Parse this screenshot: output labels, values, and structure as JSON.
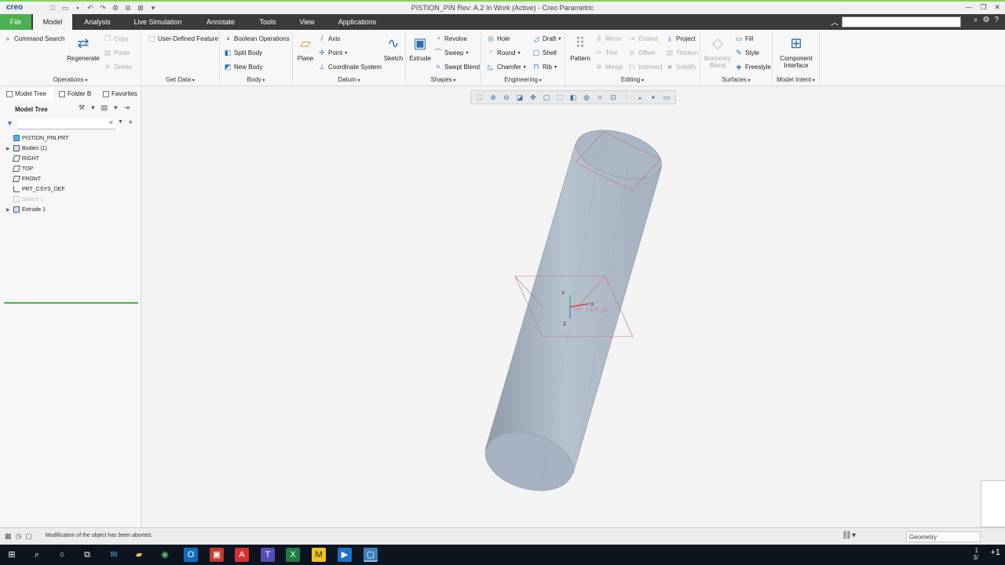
{
  "titlebar": {
    "logo": "creo",
    "window_title": "PISTION_PIN Rev: A.2 In Work  (Active) - Creo Parametric"
  },
  "tabs": [
    "File",
    "Model",
    "Analysis",
    "Live Simulation",
    "Annotate",
    "Tools",
    "View",
    "Applications"
  ],
  "active_tab": "Model",
  "ribbon": {
    "operations": {
      "command_search": "Command Search",
      "regenerate": "Regenerate",
      "copy": "Copy",
      "paste": "Paste",
      "delete": "Delete",
      "title": "Operations"
    },
    "get_data": {
      "user_defined_feature": "User-Defined Feature",
      "title": "Get Data"
    },
    "body": {
      "boolean_operations": "Boolean Operations",
      "split_body": "Split Body",
      "new_body": "New Body",
      "title": "Body"
    },
    "datum": {
      "plane": "Plane",
      "axis": "Axis",
      "point": "Point",
      "coordinate_system": "Coordinate System",
      "sketch": "Sketch",
      "title": "Datum"
    },
    "shapes": {
      "extrude": "Extrude",
      "revolve": "Revolve",
      "sweep": "Sweep",
      "swept_blend": "Swept Blend",
      "title": "Shapes"
    },
    "engineering": {
      "hole": "Hole",
      "round": "Round",
      "chamfer": "Chamfer",
      "draft": "Draft",
      "shell": "Shell",
      "rib": "Rib",
      "title": "Engineering"
    },
    "editing": {
      "pattern": "Pattern",
      "mirror": "Mirror",
      "trim": "Trim",
      "merge": "Merge",
      "extend": "Extend",
      "offset": "Offset",
      "intersect": "Intersect",
      "project": "Project",
      "thicken": "Thicken",
      "solidify": "Solidify",
      "title": "Editing"
    },
    "surfaces": {
      "boundary_blend_1": "Boundary",
      "boundary_blend_2": "Blend",
      "fill": "Fill",
      "style": "Style",
      "freestyle": "Freestyle",
      "title": "Surfaces"
    },
    "model_intent": {
      "component_interface_1": "Component",
      "component_interface_2": "Interface",
      "title": "Model Intent"
    }
  },
  "left_panel": {
    "tabs": [
      "Model Tree",
      "Folder B",
      "Favorites"
    ],
    "tree_title": "Model Tree",
    "tree_nodes": [
      {
        "label": "PISTION_PIN.PRT",
        "expand": ""
      },
      {
        "label": "Bodies (1)",
        "expand": "▶"
      },
      {
        "label": "RIGHT",
        "expand": ""
      },
      {
        "label": "TOP",
        "expand": ""
      },
      {
        "label": "FRONT",
        "expand": ""
      },
      {
        "label": "PRT_CSYS_DEF",
        "expand": ""
      },
      {
        "label": "Sketch 1",
        "expand": ""
      },
      {
        "label": "Extrude 1",
        "expand": "▶"
      }
    ]
  },
  "graphics": {
    "csys_label": "PRT_CSYS_DEF",
    "axis_y": "Y",
    "axis_z": "Z",
    "axis_x": "X"
  },
  "statusbar": {
    "message": "Modification of the object has been aborted.",
    "selection_filter": "Geometry"
  },
  "taskbar": {
    "notification_badge": "+1"
  },
  "colors": {
    "file_tab": "#4caf50",
    "tab_bar": "#3b3b3b",
    "model_body": "#a9b6c6",
    "datum_plane": "#c2707a"
  }
}
